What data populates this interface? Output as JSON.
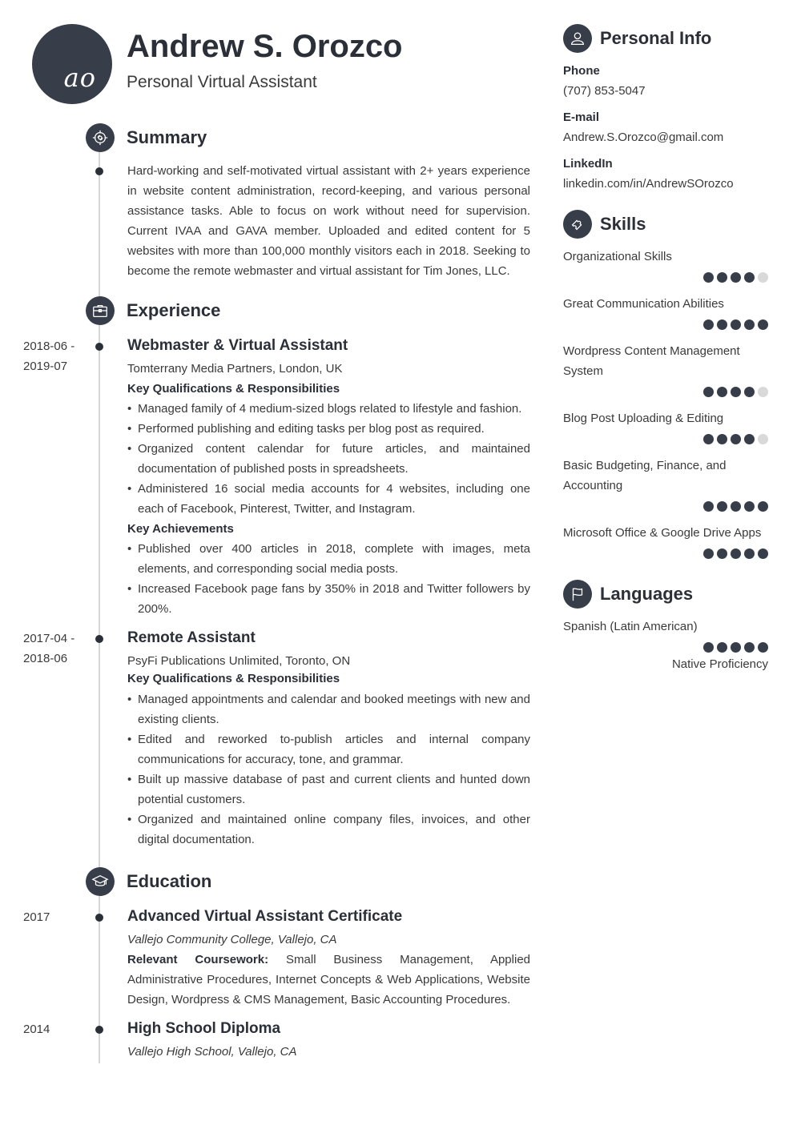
{
  "header": {
    "initials": "ao",
    "name": "Andrew S. Orozco",
    "title": "Personal Virtual Assistant"
  },
  "summary": {
    "heading": "Summary",
    "icon": "target-icon",
    "text": "Hard-working and self-motivated virtual assistant with 2+ years experience in website content administration, record-keeping, and various personal assistance tasks. Able to focus on work without need for supervision. Current IVAA and GAVA member. Uploaded and edited content for 5 websites with more than 100,000 monthly visitors each in 2018. Seeking to become the remote webmaster and virtual assistant for Tim Jones, LLC."
  },
  "experience": {
    "heading": "Experience",
    "icon": "briefcase-icon",
    "items": [
      {
        "date_start": "2018-06 -",
        "date_end": "2019-07",
        "job_title": "Webmaster & Virtual Assistant",
        "company": "Tomterrany Media Partners, London, UK",
        "qual_heading": "Key Qualifications & Responsibilities",
        "responsibilities": [
          "Managed family of 4 medium-sized blogs related to lifestyle and fashion.",
          "Performed publishing and editing tasks per blog post as required.",
          "Organized content calendar for future articles, and maintained documentation of published posts in spreadsheets.",
          "Administered 16 social media accounts for 4 websites, including one each of Facebook, Pinterest, Twitter, and Instagram."
        ],
        "ach_heading": "Key Achievements",
        "achievements": [
          "Published over 400 articles in 2018, complete with images, meta elements, and corresponding social media posts.",
          "Increased Facebook page fans by 350% in 2018 and Twitter followers by 200%."
        ]
      },
      {
        "date_start": "2017-04 -",
        "date_end": "2018-06",
        "job_title": "Remote Assistant",
        "company": "PsyFi Publications Unlimited, Toronto, ON",
        "qual_heading": "Key Qualifications & Responsibilities",
        "responsibilities": [
          "Managed appointments and calendar and booked meetings with new and existing clients.",
          "Edited and reworked to-publish articles and internal company communications for accuracy, tone, and grammar.",
          "Built up massive database of past and current clients and hunted down potential customers.",
          "Organized and maintained online company files, invoices, and other digital documentation."
        ]
      }
    ]
  },
  "education": {
    "heading": "Education",
    "icon": "graduation-cap-icon",
    "items": [
      {
        "year": "2017",
        "degree": "Advanced Virtual Assistant Certificate",
        "school": "Vallejo Community College, Vallejo, CA",
        "coursework_label": "Relevant Coursework:",
        "coursework": "Small Business Management, Applied Administrative Procedures, Internet Concepts & Web Applications, Website Design, Wordpress & CMS Management, Basic Accounting Procedures."
      },
      {
        "year": "2014",
        "degree": "High School Diploma",
        "school": "Vallejo High School, Vallejo, CA"
      }
    ]
  },
  "personal_info": {
    "heading": "Personal Info",
    "icon": "user-icon",
    "phone_label": "Phone",
    "phone": "(707) 853-5047",
    "email_label": "E-mail",
    "email": "Andrew.S.Orozco@gmail.com",
    "linkedin_label": "LinkedIn",
    "linkedin": "linkedin.com/in/AndrewSOrozco"
  },
  "skills": {
    "heading": "Skills",
    "icon": "puzzle-icon",
    "max_rating": 5,
    "items": [
      {
        "name": "Organizational Skills",
        "rating": 4
      },
      {
        "name": "Great Communication Abilities",
        "rating": 5
      },
      {
        "name": "Wordpress Content Management System",
        "rating": 4
      },
      {
        "name": "Blog Post Uploading & Editing",
        "rating": 4
      },
      {
        "name": "Basic Budgeting, Finance, and Accounting",
        "rating": 5
      },
      {
        "name": "Microsoft Office & Google Drive Apps",
        "rating": 5
      }
    ]
  },
  "languages": {
    "heading": "Languages",
    "icon": "flag-icon",
    "items": [
      {
        "name": "Spanish (Latin American)",
        "rating": 5,
        "level": "Native Proficiency"
      }
    ]
  },
  "colors": {
    "accent": "#373d49",
    "heading_text": "#2b2f38",
    "body_text": "#3a3a3a",
    "timeline": "#d6d6d6",
    "rating_off": "#d9d9d9"
  }
}
